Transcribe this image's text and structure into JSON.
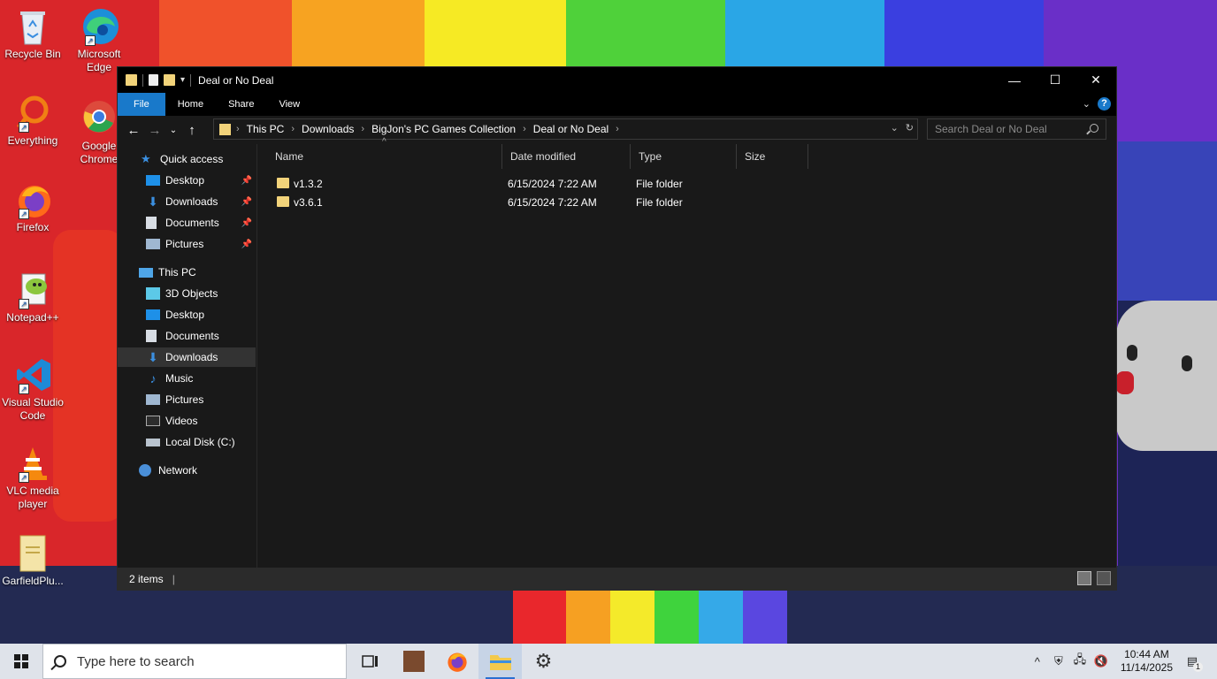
{
  "desktop": {
    "icons": [
      {
        "label": "Recycle Bin",
        "icon": "recycle-bin-icon"
      },
      {
        "label": "Microsoft Edge",
        "icon": "edge-icon"
      },
      {
        "label": "Everything",
        "icon": "everything-icon"
      },
      {
        "label": "Google Chrome",
        "icon": "chrome-icon"
      },
      {
        "label": "Firefox",
        "icon": "firefox-icon"
      },
      {
        "label": "Notepad++",
        "icon": "notepadpp-icon"
      },
      {
        "label": "Visual Studio Code",
        "icon": "vscode-icon"
      },
      {
        "label": "VLC media player",
        "icon": "vlc-icon"
      },
      {
        "label": "GarfieldPlu...",
        "icon": "document-icon"
      }
    ]
  },
  "window": {
    "title": "Deal or No Deal",
    "controls": {
      "minimize": "—",
      "maximize": "☐",
      "close": "✕"
    },
    "ribbon_tabs": [
      "File",
      "Home",
      "Share",
      "View"
    ],
    "address": {
      "crumbs": [
        "This PC",
        "Downloads",
        "BigJon's PC Games Collection",
        "Deal or No Deal"
      ]
    },
    "search": {
      "placeholder": "Search Deal or No Deal"
    },
    "nav": {
      "quick_access": "Quick access",
      "quick_items": [
        "Desktop",
        "Downloads",
        "Documents",
        "Pictures"
      ],
      "this_pc": "This PC",
      "pc_items": [
        "3D Objects",
        "Desktop",
        "Documents",
        "Downloads",
        "Music",
        "Pictures",
        "Videos",
        "Local Disk (C:)"
      ],
      "network": "Network",
      "selected": "Downloads"
    },
    "columns": [
      "Name",
      "Date modified",
      "Type",
      "Size"
    ],
    "files": [
      {
        "name": "v1.3.2",
        "date": "6/15/2024 7:22 AM",
        "type": "File folder",
        "size": ""
      },
      {
        "name": "v3.6.1",
        "date": "6/15/2024 7:22 AM",
        "type": "File folder",
        "size": ""
      }
    ],
    "status": "2 items"
  },
  "taskbar": {
    "search_placeholder": "Type here to search",
    "apps": [
      "task-view-icon",
      "media-thumbnail-icon",
      "firefox-icon",
      "file-explorer-icon",
      "settings-icon"
    ],
    "active_app": "file-explorer-icon",
    "time": "10:44 AM",
    "date": "11/14/2025",
    "notification_count": "1"
  },
  "colors": {
    "accent": "#1979ca",
    "folder": "#f2d37a",
    "window_bg": "#191919"
  }
}
